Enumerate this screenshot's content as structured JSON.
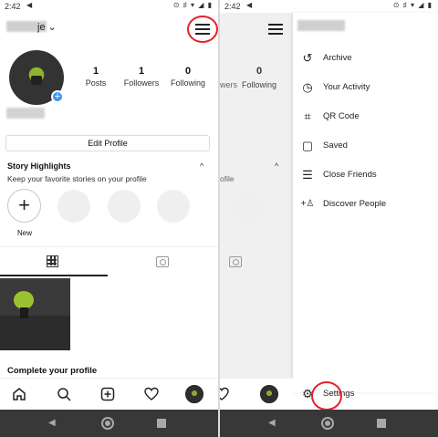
{
  "left_screen": {
    "status": {
      "time": "2:42",
      "arrow": "◀",
      "icons": "⊙ ♯ ▾ ◢ ▮"
    },
    "header": {
      "username_visible": "je ⌄"
    },
    "stats": [
      {
        "num": "1",
        "label": "Posts"
      },
      {
        "num": "1",
        "label": "Followers"
      },
      {
        "num": "0",
        "label": "Following"
      }
    ],
    "edit_profile": "Edit Profile",
    "story_highlights": {
      "title": "Story Highlights",
      "caret": "^",
      "subtitle": "Keep your favorite stories on your profile",
      "new_label": "New",
      "new_plus": "+"
    },
    "complete_profile": "Complete your profile"
  },
  "right_screen": {
    "status": {
      "time": "2:42",
      "arrow": "◀",
      "icons": "⊙ ♯ ▾ ◢ ▮"
    },
    "ghost": {
      "stat_label": "wers",
      "following_num": "0",
      "following_label": "Following",
      "bio_label": "ofile"
    },
    "menu_items": [
      {
        "icon": "↺",
        "label": "Archive"
      },
      {
        "icon": "◷",
        "label": "Your Activity"
      },
      {
        "icon": "⌗",
        "label": "QR Code"
      },
      {
        "icon": "▢",
        "label": "Saved"
      },
      {
        "icon": "☰",
        "label": "Close Friends"
      },
      {
        "icon": "+♙",
        "label": "Discover People"
      },
      {
        "icon": "⚙",
        "label": "Settings"
      }
    ]
  },
  "nav": {
    "back": "◀"
  },
  "colors": {
    "highlight_ring": "#e8202a",
    "accent_blue": "#3897f0",
    "navbar": "#383838"
  }
}
